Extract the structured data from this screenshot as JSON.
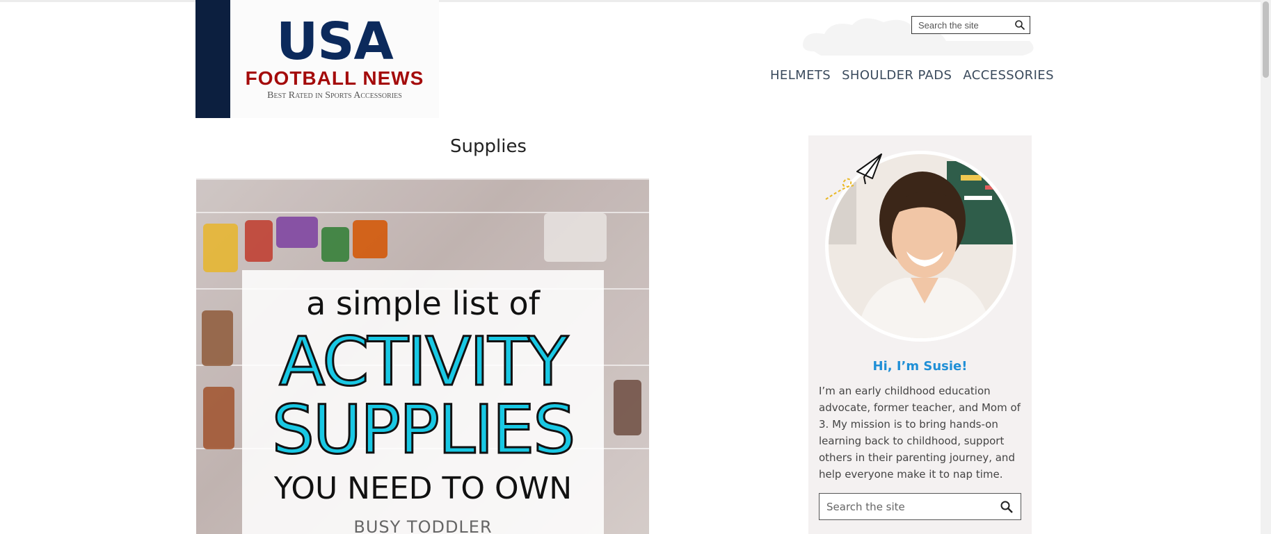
{
  "header": {
    "logo": {
      "usa": "USA",
      "football_news": "FOOTBALL NEWS",
      "tagline": "Best Rated in Sports Accessories"
    },
    "search_placeholder": "Search the site",
    "nav": [
      {
        "label": "HELMETS"
      },
      {
        "label": "SHOULDER PADS"
      },
      {
        "label": "ACCESSORIES"
      }
    ]
  },
  "main": {
    "page_title": "Supplies",
    "hero_image": {
      "line1": "a simple list of",
      "line2": "ACTIVITY",
      "line3": "SUPPLIES",
      "line4": "YOU NEED TO OWN",
      "line5": "BUSY TODDLER"
    }
  },
  "sidebar": {
    "greeting": "Hi, I’m Susie!",
    "bio": "I’m an early childhood education advocate, former teacher, and Mom of 3. My mission is to bring hands-on learning back to childhood, support others in their parenting journey, and help everyone make it to nap time.",
    "search_placeholder": "Search the site"
  },
  "colors": {
    "logo_navy": "#0c1f3f",
    "logo_red": "#a40b0b",
    "accent_blue": "#1f8fd6",
    "hero_cyan": "#19c8e4",
    "sidebar_bg": "#f4f1f1"
  },
  "icons": [
    "search-icon",
    "paper-plane-icon"
  ]
}
